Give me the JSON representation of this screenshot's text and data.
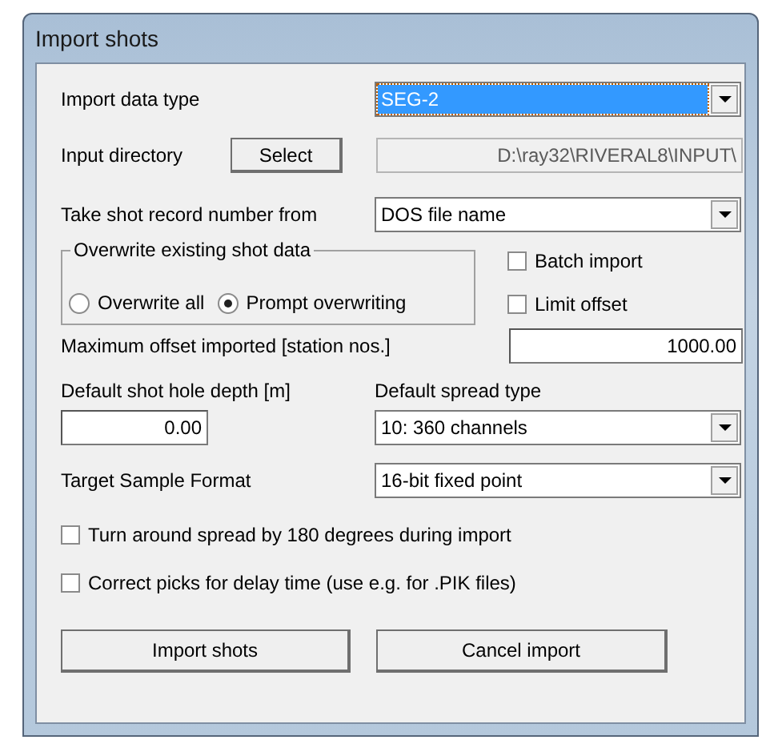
{
  "window": {
    "title": "Import shots"
  },
  "import_data_type": {
    "label": "Import data type",
    "value": "SEG-2",
    "highlighted": true
  },
  "input_directory": {
    "label": "Input directory",
    "button": {
      "label": "Select"
    },
    "value": "D:\\ray32\\RIVERAL8\\INPUT\\",
    "disabled": true
  },
  "shot_record_number": {
    "label": "Take shot record number from",
    "value": "DOS file name"
  },
  "overwrite": {
    "title": "Overwrite existing shot data",
    "options": [
      {
        "label": "Overwrite all",
        "selected": false
      },
      {
        "label": "Prompt overwriting",
        "selected": true
      }
    ]
  },
  "side_checks": [
    {
      "label": "Batch import",
      "checked": false
    },
    {
      "label": "Limit offset",
      "checked": false
    }
  ],
  "max_offset": {
    "label": "Maximum offset imported [station nos.]",
    "value": "1000.00"
  },
  "shot_hole_depth": {
    "label": "Default shot hole depth [m]",
    "value": "0.00"
  },
  "spread_type": {
    "label": "Default spread type",
    "value": "10: 360 channels"
  },
  "sample_format": {
    "label": "Target Sample Format",
    "value": "16-bit fixed point"
  },
  "options": [
    {
      "label": "Turn around spread by 180 degrees during import",
      "checked": false
    },
    {
      "label": "Correct picks for delay time (use e.g. for .PIK files)",
      "checked": false
    }
  ],
  "buttons": [
    {
      "label": "Import shots"
    },
    {
      "label": "Cancel import"
    }
  ]
}
